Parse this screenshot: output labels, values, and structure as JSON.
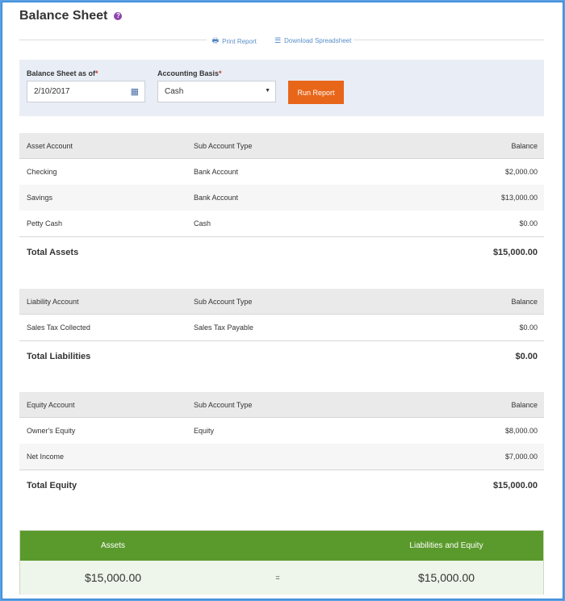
{
  "page": {
    "title": "Balance Sheet"
  },
  "actions": {
    "print": "Print Report",
    "download": "Download Spreadsheet"
  },
  "filters": {
    "as_of_label": "Balance Sheet as of",
    "as_of_value": "2/10/2017",
    "basis_label": "Accounting Basis",
    "basis_value": "Cash",
    "required_mark": "*",
    "run_button": "Run Report"
  },
  "assets": {
    "headers": [
      "Asset Account",
      "Sub Account Type",
      "Balance"
    ],
    "rows": [
      [
        "Checking",
        "Bank Account",
        "$2,000.00"
      ],
      [
        "Savings",
        "Bank Account",
        "$13,000.00"
      ],
      [
        "Petty Cash",
        "Cash",
        "$0.00"
      ]
    ],
    "total_label": "Total Assets",
    "total_value": "$15,000.00"
  },
  "liabilities": {
    "headers": [
      "Liability Account",
      "Sub Account Type",
      "Balance"
    ],
    "rows": [
      [
        "Sales Tax Collected",
        "Sales Tax Payable",
        "$0.00"
      ]
    ],
    "total_label": "Total Liabilities",
    "total_value": "$0.00"
  },
  "equity": {
    "headers": [
      "Equity Account",
      "Sub Account Type",
      "Balance"
    ],
    "rows": [
      [
        "Owner's Equity",
        "Equity",
        "$8,000.00"
      ],
      [
        "Net Income",
        "",
        "$7,000.00"
      ]
    ],
    "total_label": "Total Equity",
    "total_value": "$15,000.00"
  },
  "summary": {
    "assets_label": "Assets",
    "le_label": "Liabilities and Equity",
    "assets_value": "$15,000.00",
    "equals": "=",
    "le_value": "$15,000.00"
  },
  "colors": {
    "accent": "#e8661a",
    "summary_green": "#5a9a2c",
    "help": "#8e44ad"
  },
  "icons": {
    "help": "question-icon",
    "print": "printer-icon",
    "download": "list-icon",
    "calendar": "calendar-icon",
    "caret": "caret-down-icon"
  }
}
